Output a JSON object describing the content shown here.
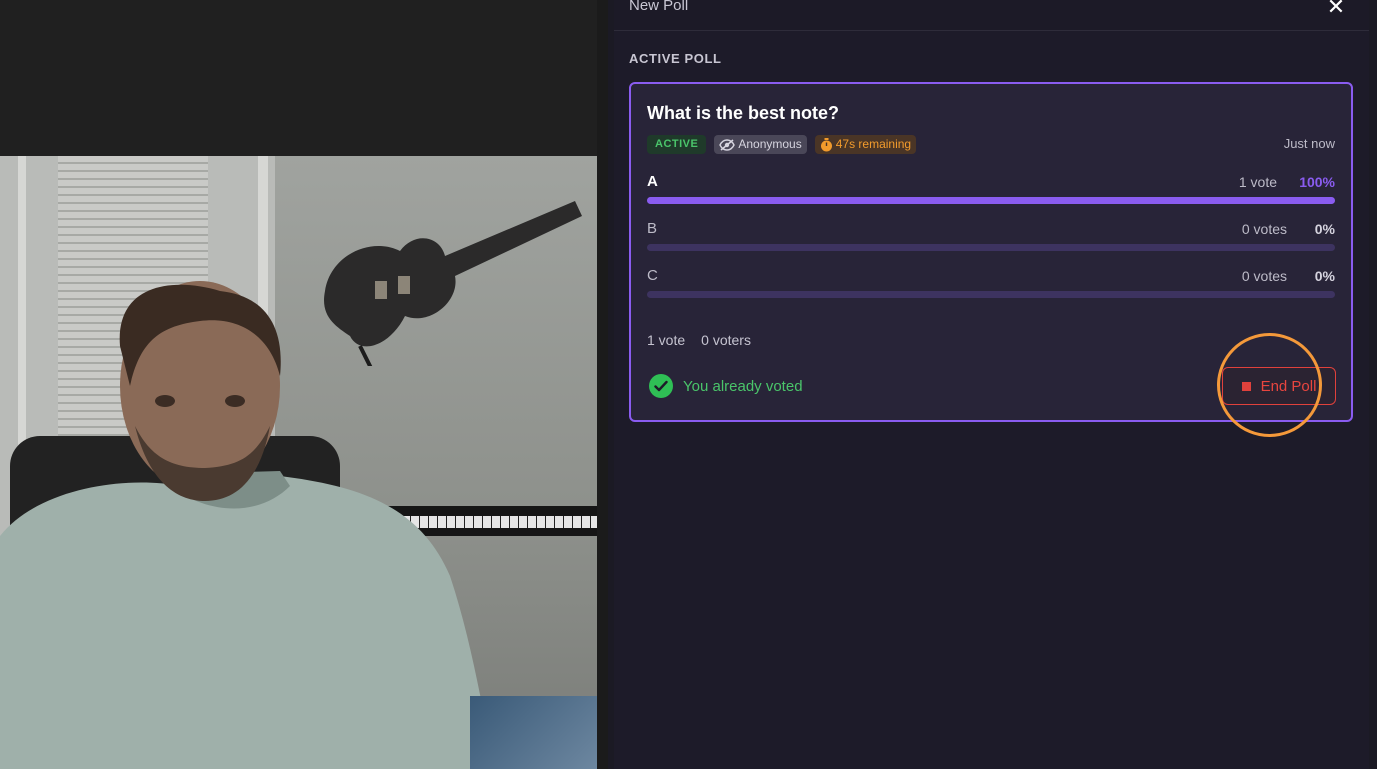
{
  "panel": {
    "title": "New Poll",
    "close_icon": "close-icon",
    "section_label": "ACTIVE POLL"
  },
  "poll": {
    "question": "What is the best note?",
    "badges": {
      "status": "ACTIVE",
      "anonymous": "Anonymous",
      "timer": "47s remaining"
    },
    "timestamp": "Just now",
    "options": [
      {
        "label": "A",
        "votes": "1 vote",
        "percent": "100%",
        "fraction": 1.0
      },
      {
        "label": "B",
        "votes": "0 votes",
        "percent": "0%",
        "fraction": 0.0
      },
      {
        "label": "C",
        "votes": "0 votes",
        "percent": "0%",
        "fraction": 0.0
      }
    ],
    "total_votes": "1 vote",
    "total_voters": "0 voters",
    "voted_message": "You already voted",
    "end_button": "End Poll"
  },
  "colors": {
    "accent": "#8a5cf0",
    "active_green": "#4ac46a",
    "timer_orange": "#f29b2c",
    "danger": "#e0413c",
    "highlight": "#f4993a"
  }
}
